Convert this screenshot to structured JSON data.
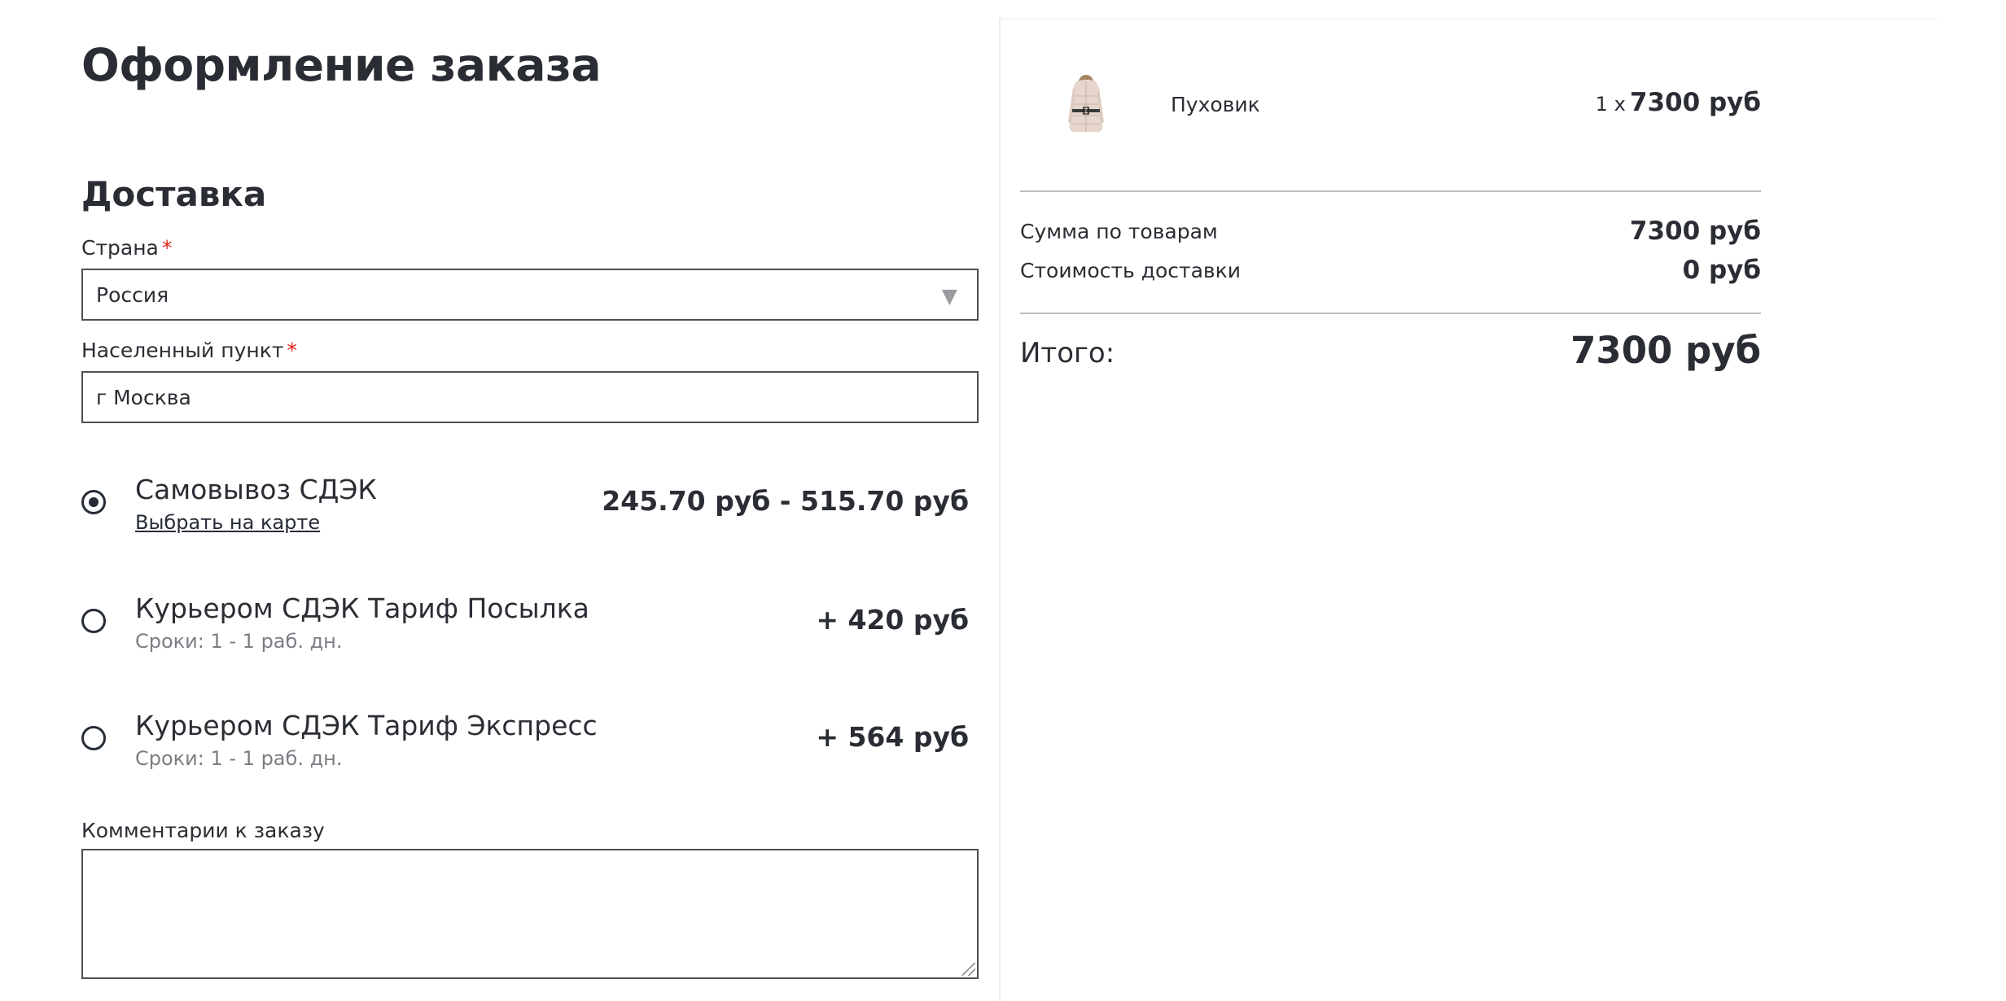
{
  "page": {
    "title": "Оформление заказа"
  },
  "delivery": {
    "section_title": "Доставка",
    "country": {
      "label": "Страна",
      "required_mark": "*",
      "value": "Россия"
    },
    "city": {
      "label": "Населенный пункт",
      "required_mark": "*",
      "value": "г Москва"
    },
    "options": [
      {
        "name": "Самовывоз СДЭК",
        "sub": "Выбрать на карте",
        "price": "245.70 руб - 515.70 руб",
        "selected": true
      },
      {
        "name": "Курьером СДЭК Тариф Посылка",
        "sub": "Сроки: 1 - 1 раб. дн.",
        "price": "+ 420 руб",
        "selected": false
      },
      {
        "name": "Курьером СДЭК Тариф Экспресс",
        "sub": "Сроки: 1 - 1 раб. дн.",
        "price": "+ 564 руб",
        "selected": false
      }
    ],
    "comment": {
      "label": "Комментарии к заказу",
      "value": ""
    }
  },
  "summary": {
    "item": {
      "name": "Пуховик",
      "qty": "1 x",
      "price": "7300 руб",
      "thumb_icon": "down-jacket-thumbnail"
    },
    "goods_label": "Сумма по товарам",
    "goods_value": "7300 руб",
    "shipping_label": "Стоимость доставки",
    "shipping_value": "0 руб",
    "total_label": "Итого:",
    "total_value": "7300 руб"
  },
  "colors": {
    "text": "#2a2d33",
    "required": "#e1251b",
    "muted": "#7b7e84",
    "border": "#4d4f54",
    "divider": "#bdbdbd"
  }
}
